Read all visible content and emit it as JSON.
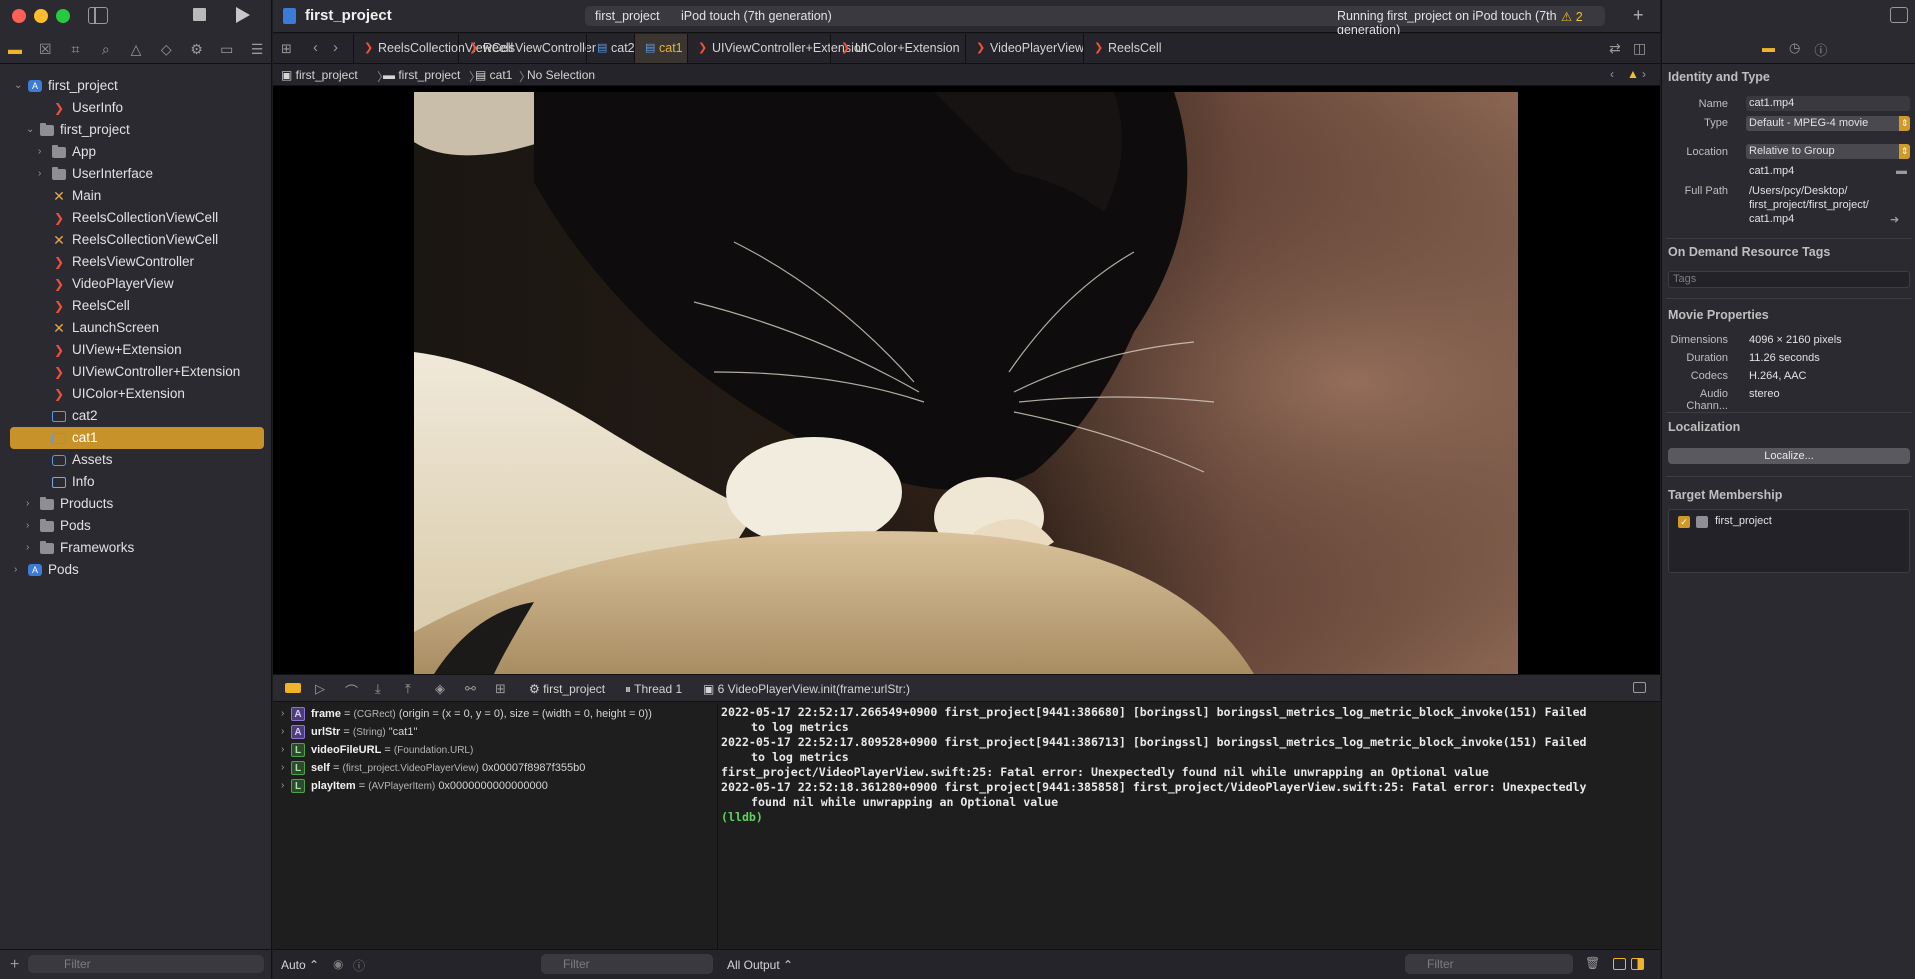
{
  "window": {
    "project_title": "first_project"
  },
  "toolbar": {
    "scheme_app": "first_project",
    "scheme_device": "iPod touch (7th generation)",
    "status": "Running first_project on iPod touch (7th generation)",
    "warning_count": "2",
    "add_label": "+"
  },
  "navigator": {
    "tree": [
      {
        "label": "first_project",
        "icon": "project-icon",
        "level": 0,
        "disclosure": "open"
      },
      {
        "label": "UserInfo",
        "icon": "swift-icon",
        "level": 2,
        "disclosure": ""
      },
      {
        "label": "first_project",
        "icon": "folder-icon",
        "level": 1,
        "disclosure": "open"
      },
      {
        "label": "App",
        "icon": "folder-icon",
        "level": 2,
        "disclosure": "closed"
      },
      {
        "label": "UserInterface",
        "icon": "folder-icon",
        "level": 2,
        "disclosure": "closed"
      },
      {
        "label": "Main",
        "icon": "xib-icon",
        "level": 2,
        "disclosure": ""
      },
      {
        "label": "ReelsCollectionViewCell",
        "icon": "swift-icon",
        "level": 2,
        "disclosure": ""
      },
      {
        "label": "ReelsCollectionViewCell",
        "icon": "xib-icon",
        "level": 2,
        "disclosure": ""
      },
      {
        "label": "ReelsViewController",
        "icon": "swift-icon",
        "level": 2,
        "disclosure": ""
      },
      {
        "label": "VideoPlayerView",
        "icon": "swift-icon",
        "level": 2,
        "disclosure": ""
      },
      {
        "label": "ReelsCell",
        "icon": "swift-icon",
        "level": 2,
        "disclosure": ""
      },
      {
        "label": "LaunchScreen",
        "icon": "xib-icon",
        "level": 2,
        "disclosure": ""
      },
      {
        "label": "UIView+Extension",
        "icon": "swift-icon",
        "level": 2,
        "disclosure": ""
      },
      {
        "label": "UIViewController+Extension",
        "icon": "swift-icon",
        "level": 2,
        "disclosure": ""
      },
      {
        "label": "UIColor+Extension",
        "icon": "swift-icon",
        "level": 2,
        "disclosure": ""
      },
      {
        "label": "cat2",
        "icon": "movie-icon",
        "level": 2,
        "disclosure": ""
      },
      {
        "label": "cat1",
        "icon": "movie-icon",
        "level": 2,
        "disclosure": "",
        "selected": true
      },
      {
        "label": "Assets",
        "icon": "assets-icon",
        "level": 2,
        "disclosure": ""
      },
      {
        "label": "Info",
        "icon": "plist-icon",
        "level": 2,
        "disclosure": ""
      },
      {
        "label": "Products",
        "icon": "folder-icon",
        "level": 1,
        "disclosure": "closed"
      },
      {
        "label": "Pods",
        "icon": "folder-icon",
        "level": 1,
        "disclosure": "closed"
      },
      {
        "label": "Frameworks",
        "icon": "folder-icon",
        "level": 1,
        "disclosure": "closed"
      },
      {
        "label": "Pods",
        "icon": "project-icon",
        "level": 0,
        "disclosure": "closed"
      }
    ],
    "filter_placeholder": "Filter"
  },
  "tabs": [
    {
      "label": "ReelsCollectionViewCell",
      "icon": "swift-icon"
    },
    {
      "label": "ReelsViewController",
      "icon": "swift-icon"
    },
    {
      "label": "cat2",
      "icon": "movie-icon"
    },
    {
      "label": "cat1",
      "icon": "movie-icon",
      "active": true
    },
    {
      "label": "UIViewController+Extension",
      "icon": "swift-icon"
    },
    {
      "label": "UIColor+Extension",
      "icon": "swift-icon"
    },
    {
      "label": "VideoPlayerView",
      "icon": "swift-icon"
    },
    {
      "label": "ReelsCell",
      "icon": "swift-icon"
    }
  ],
  "jumpbar": {
    "crumbs": [
      "first_project",
      "first_project",
      "cat1",
      "No Selection"
    ]
  },
  "debug": {
    "crumbs": [
      "first_project",
      "Thread 1",
      "6 VideoPlayerView.init(frame:urlStr:)"
    ]
  },
  "variables": [
    {
      "badge": "A",
      "name": "frame",
      "type": "(CGRect)",
      "value": "(origin = (x = 0, y = 0), size = (width = 0, height = 0))"
    },
    {
      "badge": "A",
      "name": "urlStr",
      "type": "(String)",
      "value": "\"cat1\""
    },
    {
      "badge": "L",
      "name": "videoFileURL",
      "type": "(Foundation.URL)",
      "value": ""
    },
    {
      "badge": "L",
      "name": "self",
      "type": "(first_project.VideoPlayerView)",
      "value": "0x00007f8987f355b0"
    },
    {
      "badge": "L",
      "name": "playItem",
      "type": "(AVPlayerItem)",
      "value": "0x0000000000000000"
    }
  ],
  "console": [
    {
      "text": "2022-05-17 22:52:17.266549+0900 first_project[9441:386680] [boringssl] boringssl_metrics_log_metric_block_invoke(151) Failed",
      "style": ""
    },
    {
      "text": "to log metrics",
      "style": "indent"
    },
    {
      "text": "2022-05-17 22:52:17.809528+0900 first_project[9441:386713] [boringssl] boringssl_metrics_log_metric_block_invoke(151) Failed",
      "style": ""
    },
    {
      "text": "to log metrics",
      "style": "indent"
    },
    {
      "text": "first_project/VideoPlayerView.swift:25: Fatal error: Unexpectedly found nil while unwrapping an Optional value",
      "style": ""
    },
    {
      "text": "2022-05-17 22:52:18.361280+0900 first_project[9441:385858] first_project/VideoPlayerView.swift:25: Fatal error: Unexpectedly",
      "style": ""
    },
    {
      "text": "found nil while unwrapping an Optional value",
      "style": "indent"
    },
    {
      "text": "(lldb)",
      "style": "prompt"
    }
  ],
  "bottombar": {
    "auto_label": "Auto ⌃",
    "filter1_placeholder": "Filter",
    "output_label": "All Output ⌃",
    "filter2_placeholder": "Filter"
  },
  "inspector": {
    "identity_heading": "Identity and Type",
    "name_key": "Name",
    "name_value": "cat1.mp4",
    "type_key": "Type",
    "type_value": "Default - MPEG-4 movie",
    "location_key": "Location",
    "location_value": "Relative to Group",
    "location_file": "cat1.mp4",
    "fullpath_key": "Full Path",
    "fullpath_line1": "/Users/pcy/Desktop/",
    "fullpath_line2": "first_project/first_project/",
    "fullpath_line3": "cat1.mp4",
    "odr_heading": "On Demand Resource Tags",
    "tags_placeholder": "Tags",
    "movie_heading": "Movie Properties",
    "dimensions_key": "Dimensions",
    "dimensions_value": "4096 × 2160 pixels",
    "duration_key": "Duration",
    "duration_value": "11.26 seconds",
    "codecs_key": "Codecs",
    "codecs_value": "H.264, AAC",
    "audio_key": "Audio Chann...",
    "audio_value": "stereo",
    "localization_heading": "Localization",
    "localize_button": "Localize...",
    "target_heading": "Target Membership",
    "target_name": "first_project"
  },
  "colors": {
    "accent": "#f0b429",
    "selection": "#c7922a",
    "console_prompt": "#5fd35f"
  }
}
